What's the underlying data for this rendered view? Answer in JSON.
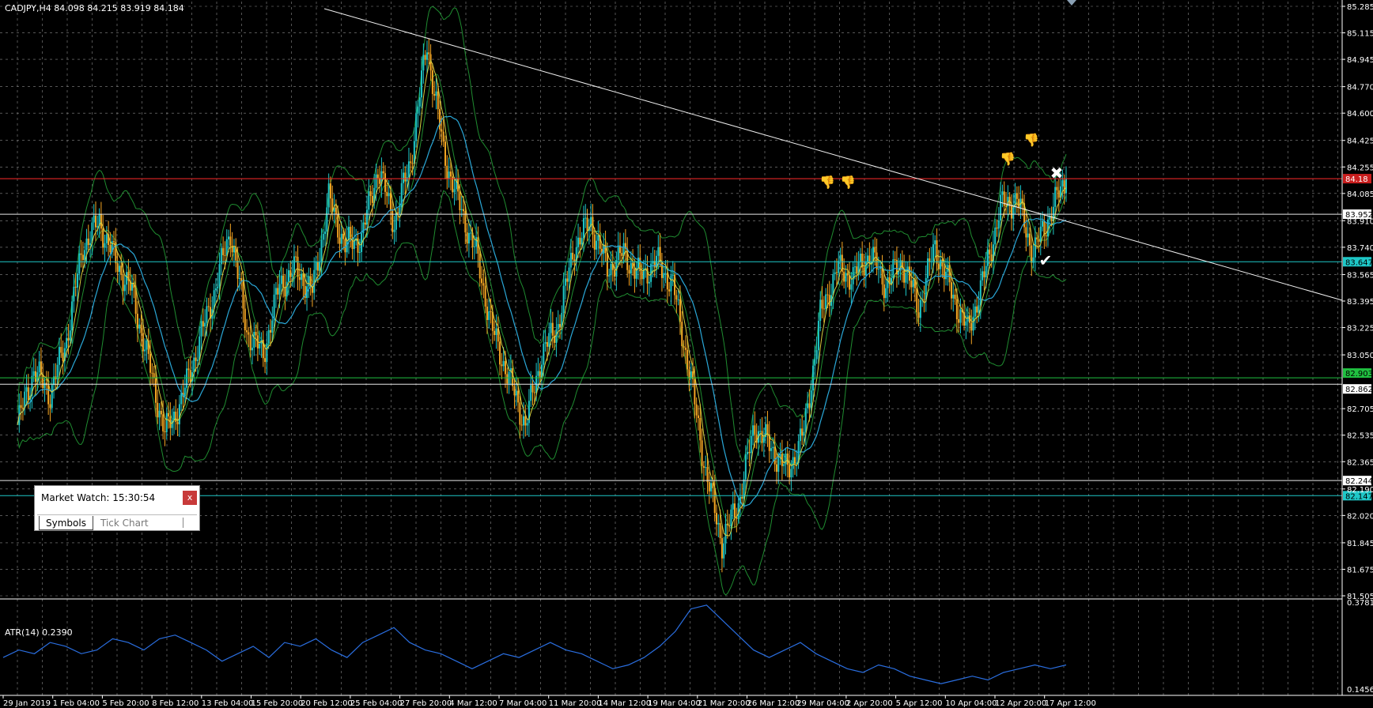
{
  "header": {
    "symbol_info": "CADJPY,H4  84.098 84.215 83.919 84.184"
  },
  "price_axis": {
    "ticks": [
      "85.285",
      "85.115",
      "84.945",
      "84.770",
      "84.600",
      "84.425",
      "84.255",
      "84.085",
      "83.910",
      "83.740",
      "83.565",
      "83.395",
      "83.225",
      "83.050",
      "82.705",
      "82.535",
      "82.365",
      "82.190",
      "82.020",
      "81.845",
      "81.675",
      "81.505"
    ],
    "tick_values": [
      85.285,
      85.115,
      84.945,
      84.77,
      84.6,
      84.425,
      84.255,
      84.085,
      83.91,
      83.74,
      83.565,
      83.395,
      83.225,
      83.05,
      82.705,
      82.535,
      82.365,
      82.19,
      82.02,
      81.845,
      81.675,
      81.505
    ],
    "range": [
      81.505,
      85.285
    ]
  },
  "level_lines": [
    {
      "value": 84.18,
      "label": "84.18",
      "color": "#ff2a2a",
      "label_bg": "#c81e1e",
      "label_color": "#ffffff"
    },
    {
      "value": 83.952,
      "label": "83.952",
      "color": "#e8e8e8",
      "label_bg": "#ffffff",
      "label_color": "#000000"
    },
    {
      "value": 83.647,
      "label": "83.647",
      "color": "#1ec8c8",
      "label_bg": "#1ec8c8",
      "label_color": "#000000"
    },
    {
      "value": 82.903,
      "label": "82.903",
      "color": "#20c040",
      "label_bg": "#20c040",
      "label_color": "#000000"
    },
    {
      "value": 82.862,
      "label": "82.862",
      "color": "#e8e8e8",
      "label_bg": "#ffffff",
      "label_color": "#000000"
    },
    {
      "value": 82.244,
      "label": "82.244",
      "color": "#e8e8e8",
      "label_bg": "#ffffff",
      "label_color": "#000000"
    },
    {
      "value": 82.147,
      "label": "82.147",
      "color": "#1ec8c8",
      "label_bg": "#1ec8c8",
      "label_color": "#000000"
    }
  ],
  "time_axis": {
    "labels": [
      "29 Jan 2019",
      "1 Feb 04:00",
      "5 Feb 20:00",
      "8 Feb 12:00",
      "13 Feb 04:00",
      "15 Feb 20:00",
      "20 Feb 12:00",
      "25 Feb 04:00",
      "27 Feb 20:00",
      "4 Mar 12:00",
      "7 Mar 04:00",
      "11 Mar 20:00",
      "14 Mar 12:00",
      "19 Mar 04:00",
      "21 Mar 20:00",
      "26 Mar 12:00",
      "29 Mar 04:00",
      "2 Apr 20:00",
      "5 Apr 12:00",
      "10 Apr 04:00",
      "12 Apr 20:00",
      "17 Apr 12:00"
    ]
  },
  "chart_data": {
    "type": "candlestick",
    "symbol": "CADJPY",
    "timeframe": "H4",
    "ohlc_last": {
      "open": 84.098,
      "high": 84.215,
      "low": 83.919,
      "close": 84.184
    },
    "close_path": [
      [
        "29 Jan 2019",
        82.6
      ],
      [
        "",
        82.95
      ],
      [
        "",
        82.8
      ],
      [
        "",
        83.15
      ],
      [
        "1 Feb 04:00",
        83.75
      ],
      [
        "",
        83.9
      ],
      [
        "",
        83.65
      ],
      [
        "5 Feb 20:00",
        83.45
      ],
      [
        "",
        83.0
      ],
      [
        "",
        82.55
      ],
      [
        "8 Feb 12:00",
        82.75
      ],
      [
        "",
        83.1
      ],
      [
        "",
        83.45
      ],
      [
        "13 Feb 04:00",
        83.85
      ],
      [
        "",
        83.2
      ],
      [
        "",
        83.05
      ],
      [
        "15 Feb 20:00",
        83.5
      ],
      [
        "",
        83.6
      ],
      [
        "",
        83.45
      ],
      [
        "20 Feb 12:00",
        84.05
      ],
      [
        "",
        83.75
      ],
      [
        "",
        83.8
      ],
      [
        "25 Feb 04:00",
        84.25
      ],
      [
        "",
        83.9
      ],
      [
        "",
        84.3
      ],
      [
        "27 Feb 20:00",
        85.05
      ],
      [
        "",
        84.35
      ],
      [
        "",
        84.0
      ],
      [
        "4 Mar 12:00",
        83.7
      ],
      [
        "",
        83.2
      ],
      [
        "",
        82.9
      ],
      [
        "7 Mar 04:00",
        82.6
      ],
      [
        "",
        83.05
      ],
      [
        "",
        83.25
      ],
      [
        "11 Mar 20:00",
        83.75
      ],
      [
        "",
        83.9
      ],
      [
        "",
        83.6
      ],
      [
        "14 Mar 12:00",
        83.7
      ],
      [
        "",
        83.55
      ],
      [
        "",
        83.65
      ],
      [
        "19 Mar 04:00",
        83.5
      ],
      [
        "",
        82.95
      ],
      [
        "",
        82.3
      ],
      [
        "21 Mar 20:00",
        81.85
      ],
      [
        "",
        82.1
      ],
      [
        "",
        82.6
      ],
      [
        "26 Mar 12:00",
        82.45
      ],
      [
        "",
        82.3
      ],
      [
        "",
        82.55
      ],
      [
        "29 Mar 04:00",
        83.3
      ],
      [
        "",
        83.6
      ],
      [
        "",
        83.55
      ],
      [
        "2 Apr 20:00",
        83.7
      ],
      [
        "",
        83.5
      ],
      [
        "",
        83.65
      ],
      [
        "5 Apr 12:00",
        83.35
      ],
      [
        "",
        83.75
      ],
      [
        "",
        83.45
      ],
      [
        "10 Apr 04:00",
        83.2
      ],
      [
        "",
        83.55
      ],
      [
        "",
        84.0
      ],
      [
        "12 Apr 20:00",
        84.05
      ],
      [
        "",
        83.7
      ],
      [
        "",
        83.95
      ],
      [
        "",
        84.18
      ]
    ],
    "trend_line": {
      "start": [
        "",
        85.27
      ],
      "end": [
        "",
        83.4
      ]
    },
    "marks": [
      {
        "icon": "thumbs-down-icon",
        "price": 84.13
      },
      {
        "icon": "thumbs-down-icon",
        "price": 84.13
      },
      {
        "icon": "thumbs-down-icon",
        "price": 84.28
      },
      {
        "icon": "thumbs-down-icon",
        "price": 84.4
      },
      {
        "icon": "cross-icon",
        "price": 84.18
      },
      {
        "icon": "check-icon",
        "price": 83.62
      }
    ]
  },
  "atr": {
    "label": "ATR(14) 0.2390",
    "ticks": [
      "0.3781",
      "0.1456"
    ],
    "range": [
      0.1456,
      0.3781
    ],
    "values": [
      0.23,
      0.25,
      0.24,
      0.27,
      0.26,
      0.24,
      0.25,
      0.28,
      0.27,
      0.25,
      0.28,
      0.29,
      0.27,
      0.25,
      0.22,
      0.24,
      0.26,
      0.23,
      0.27,
      0.26,
      0.28,
      0.25,
      0.23,
      0.27,
      0.29,
      0.31,
      0.27,
      0.25,
      0.24,
      0.22,
      0.2,
      0.22,
      0.24,
      0.23,
      0.25,
      0.27,
      0.25,
      0.24,
      0.22,
      0.2,
      0.21,
      0.23,
      0.26,
      0.3,
      0.36,
      0.37,
      0.33,
      0.29,
      0.25,
      0.23,
      0.25,
      0.27,
      0.24,
      0.22,
      0.2,
      0.19,
      0.21,
      0.2,
      0.18,
      0.17,
      0.16,
      0.17,
      0.18,
      0.17,
      0.19,
      0.2,
      0.21,
      0.2,
      0.21
    ]
  },
  "market_watch": {
    "title": "Market Watch: 15:30:54",
    "close_label": "x",
    "tabs": [
      "Symbols",
      "Tick Chart"
    ]
  },
  "colors": {
    "background": "#000000",
    "grid": "#8a8a8a",
    "bull": "#1ec8c8",
    "bear": "#f5a623",
    "band": "#1f8c30",
    "ma_slow": "#2aa8d8",
    "ma_fast": "#d8d040",
    "atr_line": "#2a6ee0",
    "trend_line": "#f0f0f0"
  }
}
